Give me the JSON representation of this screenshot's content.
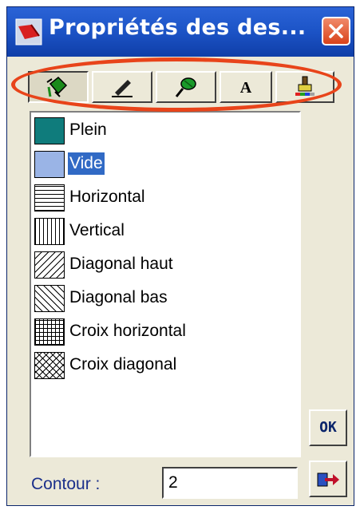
{
  "window": {
    "title": "Propriétés des des...",
    "close_icon": "close-icon",
    "app_icon": "app-brush-icon"
  },
  "toolbar": {
    "buttons": [
      {
        "icon": "fill-bucket-icon",
        "pressed": true
      },
      {
        "icon": "pen-icon",
        "pressed": false
      },
      {
        "icon": "brush-icon",
        "pressed": false
      },
      {
        "icon": "text-a-icon",
        "label": "A",
        "pressed": false
      },
      {
        "icon": "color-palette-brush-icon",
        "pressed": false
      }
    ]
  },
  "fill_styles": {
    "selected_index": 1,
    "items": [
      {
        "label": "Plein",
        "pattern": "solid",
        "color": "#0f7c7c"
      },
      {
        "label": "Vide",
        "pattern": "empty",
        "color": "#9ab4e6"
      },
      {
        "label": "Horizontal",
        "pattern": "horizontal"
      },
      {
        "label": "Vertical",
        "pattern": "vertical"
      },
      {
        "label": "Diagonal haut",
        "pattern": "diag-up"
      },
      {
        "label": "Diagonal bas",
        "pattern": "diag-down"
      },
      {
        "label": "Croix horizontal",
        "pattern": "cross"
      },
      {
        "label": "Croix diagonal",
        "pattern": "diag-cross"
      }
    ]
  },
  "buttons": {
    "ok_label": "OK",
    "exit_icon": "exit-arrow-icon"
  },
  "contour": {
    "label": "Contour :",
    "value": "2"
  },
  "colors": {
    "titlebar": "#1d55c8",
    "selection": "#316ac5",
    "highlight_oval": "#e8441a"
  }
}
